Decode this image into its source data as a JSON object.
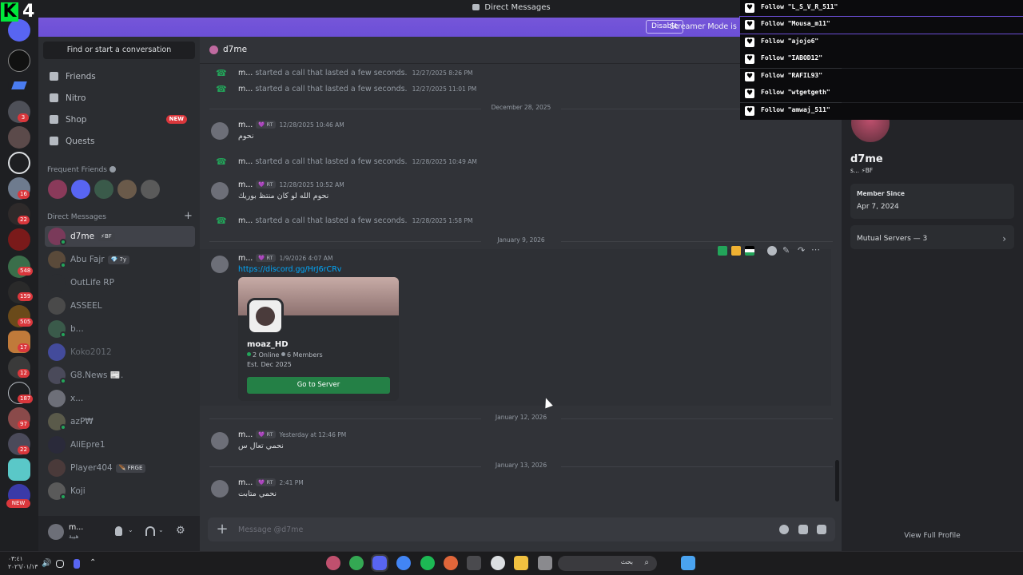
{
  "window": {
    "title": "Direct Messages",
    "overlay_counter": "4",
    "overlay_logo": "K"
  },
  "banner": {
    "text": "Streamer Mode is enabled. Usernames have been truncated.",
    "button": "Disable",
    "color": "#6b4fd6"
  },
  "rail": {
    "badges": [
      "3",
      "16",
      "22",
      "548",
      "159",
      "505",
      "17",
      "12",
      "187",
      "97",
      "22"
    ],
    "new_label": "NEW"
  },
  "sidebar": {
    "find_conversation": "Find or start a conversation",
    "nav": [
      {
        "label": "Friends",
        "icon": "friends-icon"
      },
      {
        "label": "Nitro",
        "icon": "nitro-icon"
      },
      {
        "label": "Shop",
        "icon": "shop-icon",
        "tag": "NEW"
      },
      {
        "label": "Quests",
        "icon": "quests-icon"
      }
    ],
    "frequent_friends_header": "Frequent Friends",
    "direct_messages_header": "Direct Messages",
    "add_dm": "+",
    "dms": [
      {
        "name": "d7me",
        "tag": "⚡BF",
        "status_color": "#23a55a"
      },
      {
        "name": "Abu Fajr",
        "tag": "💎 7y",
        "status_color": "#23a55a"
      },
      {
        "name": "OutLife RP",
        "tag": "",
        "status_color": ""
      },
      {
        "name": "ASSEEL",
        "tag": "",
        "status_color": ""
      },
      {
        "name": "b...",
        "tag": "",
        "status_color": "#23a55a"
      },
      {
        "name": "Koko2012",
        "tag": "",
        "status_color": ""
      },
      {
        "name": "G8.News 📰.",
        "tag": "",
        "status_color": "#23a55a"
      },
      {
        "name": "x...",
        "tag": "",
        "status_color": ""
      },
      {
        "name": "azP₩",
        "tag": "",
        "status_color": "#23a55a"
      },
      {
        "name": "AliEpre1",
        "tag": "",
        "status_color": ""
      },
      {
        "name": "Player404",
        "tag": "🪶 FRGE",
        "status_color": ""
      },
      {
        "name": "Koji",
        "tag": "",
        "status_color": "#23a55a"
      }
    ],
    "user": {
      "name": "m...",
      "status": "هيبة"
    }
  },
  "chat": {
    "recipient": "d7me",
    "placeholder": "Message @d7me",
    "items": [
      {
        "kind": "call",
        "author": "m...",
        "text": "started a call that lasted a few seconds.",
        "ts": "12/27/2025 8:26 PM"
      },
      {
        "kind": "call",
        "author": "m...",
        "text": "started a call that lasted a few seconds.",
        "ts": "12/27/2025 11:01 PM"
      },
      {
        "kind": "date",
        "label": "December 28, 2025"
      },
      {
        "kind": "msg",
        "author": "m...",
        "badge": "💜 RT",
        "ts": "12/28/2025 10:46 AM",
        "body": "نحوم"
      },
      {
        "kind": "call",
        "author": "m...",
        "text": "started a call that lasted a few seconds.",
        "ts": "12/28/2025 10:49 AM"
      },
      {
        "kind": "msg",
        "author": "m...",
        "badge": "💜 RT",
        "ts": "12/28/2025 10:52 AM",
        "body": "نحوم الله لو كان منتظ بوريك"
      },
      {
        "kind": "call",
        "author": "m...",
        "text": "started a call that lasted a few seconds.",
        "ts": "12/28/2025 1:58 PM"
      },
      {
        "kind": "date",
        "label": "January 9, 2026"
      },
      {
        "kind": "invite",
        "author": "m...",
        "badge": "💜 RT",
        "ts": "1/9/2026 4:07 AM",
        "link": "https://discord.gg/HrJ6rCRv"
      },
      {
        "kind": "date",
        "label": "January 12, 2026"
      },
      {
        "kind": "msg",
        "author": "m...",
        "badge": "💜 RT",
        "ts": "Yesterday at 12:46 PM",
        "body": "نحمي تعال س"
      },
      {
        "kind": "date",
        "label": "January 13, 2026"
      },
      {
        "kind": "msg",
        "author": "m...",
        "badge": "💜 RT",
        "ts": "2:41 PM",
        "body": "نحمي متابت"
      }
    ],
    "invite": {
      "server_name": "moaz_HD",
      "online": "2 Online",
      "members": "6 Members",
      "established": "Est. Dec 2025",
      "button": "Go to Server"
    }
  },
  "profile": {
    "name": "d7me",
    "sub": "s...  ⚡BF",
    "member_since_label": "Member Since",
    "member_since": "Apr 7, 2024",
    "mutual_servers": "Mutual Servers — 3",
    "view_full": "View Full Profile"
  },
  "follows": [
    "Follow \"L_S_V_R_511\"",
    "Follow \"Mousa_m11\"",
    "Follow \"ajojo6\"",
    "Follow \"IABOD12\"",
    "Follow \"RAFIL93\"",
    "Follow \"wtgetgeth\"",
    "Follow \"amwaj_511\""
  ],
  "taskbar": {
    "time": "٠٣:٤١",
    "date": "٢٠٢٦/٠١/١٣",
    "search": "بحث"
  }
}
